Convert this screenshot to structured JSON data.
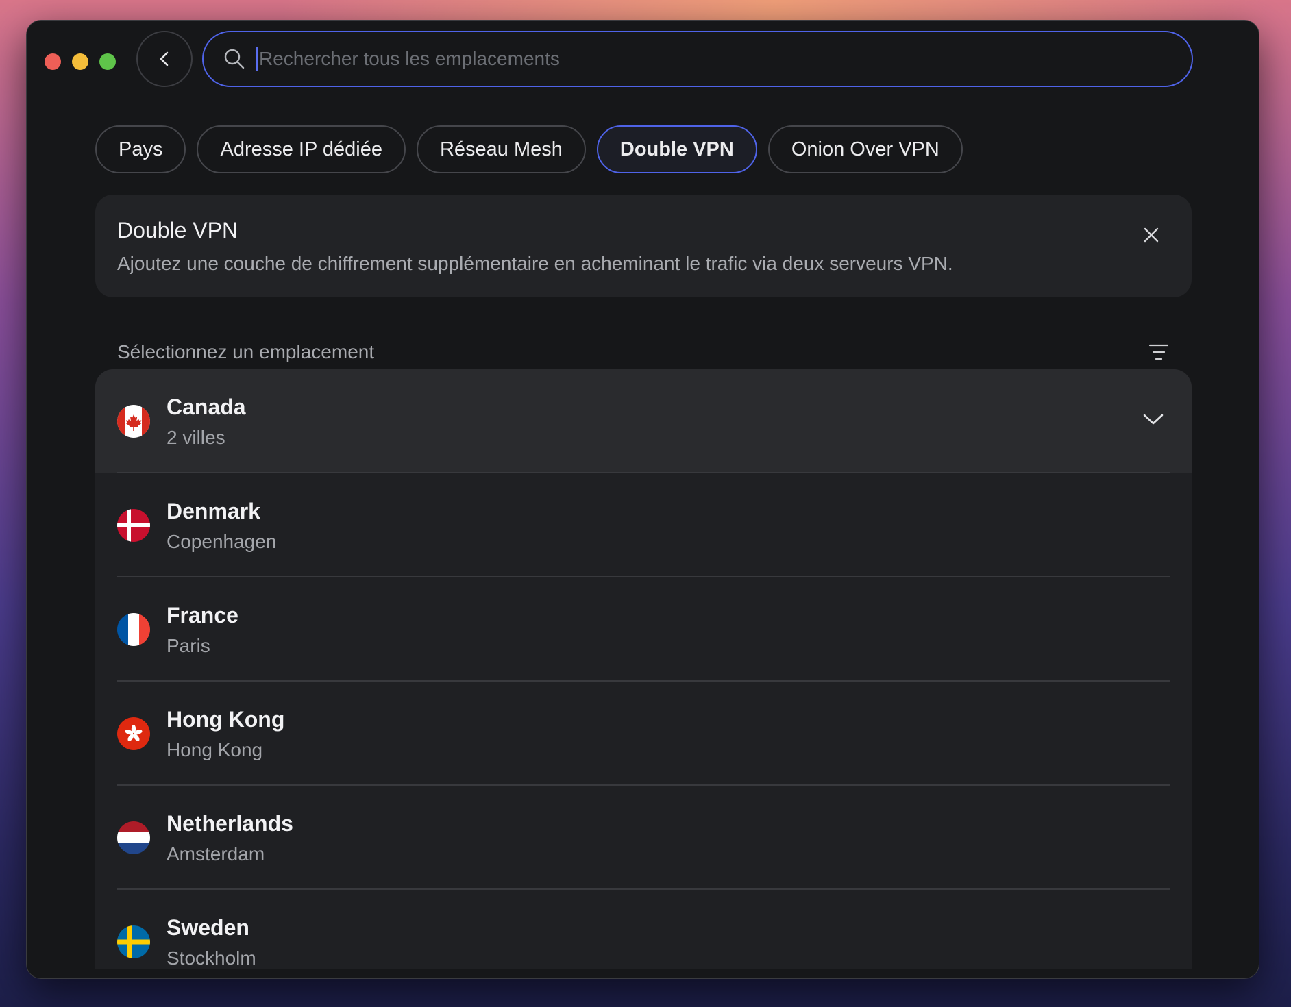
{
  "search": {
    "placeholder": "Rechercher tous les emplacements"
  },
  "tabs": [
    {
      "label": "Pays",
      "active": false
    },
    {
      "label": "Adresse IP dédiée",
      "active": false
    },
    {
      "label": "Réseau Mesh",
      "active": false
    },
    {
      "label": "Double VPN",
      "active": true
    },
    {
      "label": "Onion Over VPN",
      "active": false
    }
  ],
  "info": {
    "title": "Double VPN",
    "description": "Ajoutez une couche de chiffrement supplémentaire en acheminant le trafic via deux serveurs VPN."
  },
  "section": {
    "title": "Sélectionnez un emplacement"
  },
  "locations": [
    {
      "country": "Canada",
      "sub": "2 villes",
      "flag": "canada-flag-icon",
      "expandable": true
    },
    {
      "country": "Denmark",
      "sub": "Copenhagen",
      "flag": "denmark-flag-icon"
    },
    {
      "country": "France",
      "sub": "Paris",
      "flag": "france-flag-icon"
    },
    {
      "country": "Hong Kong",
      "sub": "Hong Kong",
      "flag": "hong-kong-flag-icon"
    },
    {
      "country": "Netherlands",
      "sub": "Amsterdam",
      "flag": "netherlands-flag-icon"
    },
    {
      "country": "Sweden",
      "sub": "Stockholm",
      "flag": "sweden-flag-icon"
    }
  ],
  "colors": {
    "accent": "#4f63e8",
    "window_bg": "#161719",
    "card_bg": "#222326"
  }
}
